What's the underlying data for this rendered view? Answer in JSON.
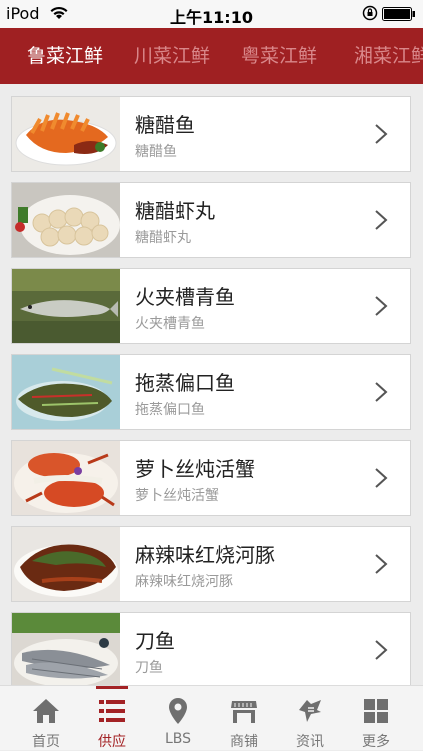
{
  "status_bar": {
    "carrier": "iPod",
    "time": "上午11:10",
    "icons": [
      "wifi-icon",
      "rotation-lock-icon",
      "battery-icon"
    ]
  },
  "tabs": [
    {
      "label": "鲁菜江鲜",
      "active": true
    },
    {
      "label": "川菜江鲜",
      "active": false
    },
    {
      "label": "粤菜江鲜",
      "active": false
    },
    {
      "label": "湘菜江鲜",
      "active": false
    }
  ],
  "items": [
    {
      "title": "糖醋鱼",
      "subtitle": "糖醋鱼",
      "image": "sweet-sour-fish-photo"
    },
    {
      "title": "糖醋虾丸",
      "subtitle": "糖醋虾丸",
      "image": "shrimp-balls-photo"
    },
    {
      "title": "火夹槽青鱼",
      "subtitle": "火夹槽青鱼",
      "image": "herring-on-grass-photo"
    },
    {
      "title": "拖蒸偏口鱼",
      "subtitle": "拖蒸偏口鱼",
      "image": "steamed-flatfish-photo"
    },
    {
      "title": "萝卜丝炖活蟹",
      "subtitle": "萝卜丝炖活蟹",
      "image": "crab-stew-photo"
    },
    {
      "title": "麻辣味红烧河豚",
      "subtitle": "麻辣味红烧河豚",
      "image": "braised-pufferfish-photo"
    },
    {
      "title": "刀鱼",
      "subtitle": "刀鱼",
      "image": "knife-fish-photo"
    }
  ],
  "bottom_nav": [
    {
      "label": "首页",
      "icon": "home-icon",
      "active": false
    },
    {
      "label": "供应",
      "icon": "list-icon",
      "active": true
    },
    {
      "label": "LBS",
      "icon": "location-pin-icon",
      "active": false
    },
    {
      "label": "商铺",
      "icon": "shop-icon",
      "active": false
    },
    {
      "label": "资讯",
      "icon": "news-icon",
      "active": false
    },
    {
      "label": "更多",
      "icon": "grid-icon",
      "active": false
    }
  ],
  "colors": {
    "accent": "#9f2022",
    "tab_inactive": "#d9878a",
    "nav_active": "#a32225"
  }
}
